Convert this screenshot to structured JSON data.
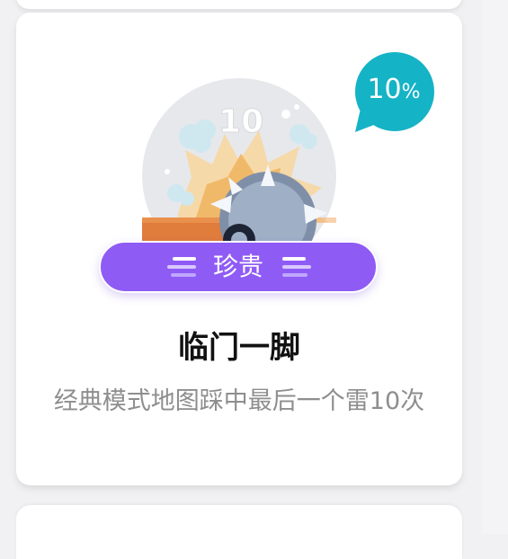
{
  "colors": {
    "badge_teal": "#15b3c6",
    "rarity_purple": "#8f5bf5",
    "title_text": "#111111",
    "desc_text": "#8e8e8e"
  },
  "achievement": {
    "completion_percent": "10",
    "completion_percent_sign": "%",
    "medal_number": "10",
    "medal_icon": "spiked-mine-icon",
    "rarity": "珍贵",
    "title": "临门一脚",
    "description": "经典模式地图踩中最后一个雷10次"
  }
}
